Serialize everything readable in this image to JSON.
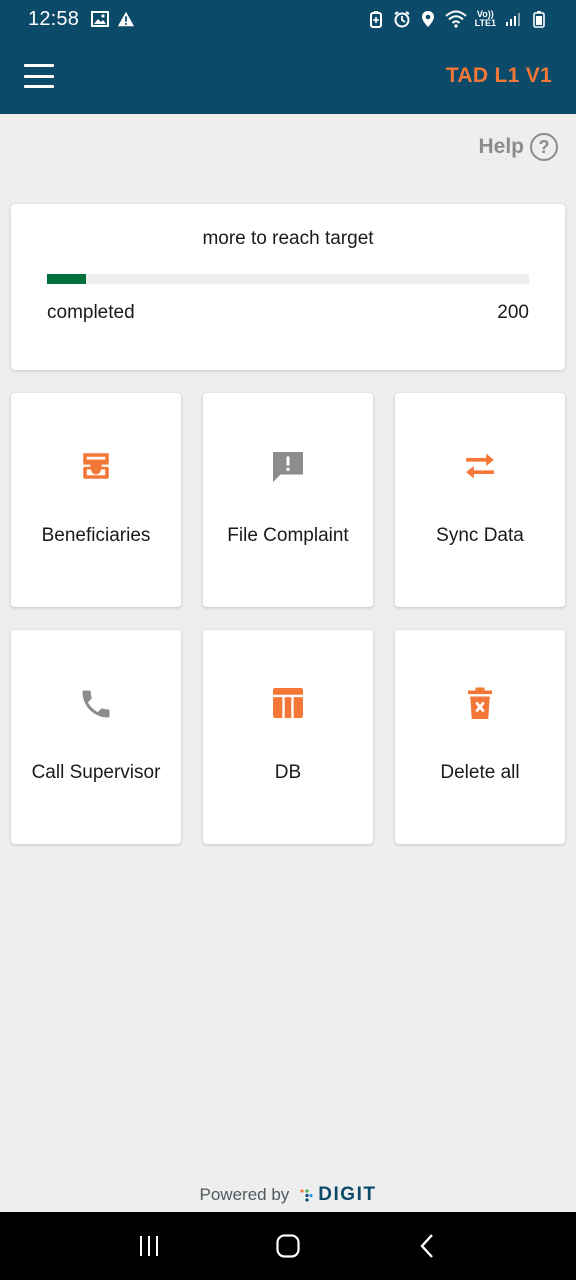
{
  "status_bar": {
    "time": "12:58",
    "network_text_top": "Vo))",
    "network_text_bottom": "LTE1"
  },
  "app_bar": {
    "title": "TAD L1 V1"
  },
  "help": {
    "label": "Help",
    "icon_glyph": "?"
  },
  "target_card": {
    "title": "more to reach target",
    "progress_fraction": 0.08,
    "left_label": "completed",
    "right_label": "200"
  },
  "tiles": [
    {
      "label": "Beneficiaries",
      "icon": "inbox-icon"
    },
    {
      "label": "File Complaint",
      "icon": "feedback-icon"
    },
    {
      "label": "Sync Data",
      "icon": "sync-arrows-icon"
    },
    {
      "label": "Call Supervisor",
      "icon": "phone-icon"
    },
    {
      "label": "DB",
      "icon": "table-icon"
    },
    {
      "label": "Delete all",
      "icon": "delete-icon"
    }
  ],
  "footer": {
    "powered_by": "Powered by",
    "brand": "DIGIT"
  },
  "colors": {
    "header": "#0b4a68",
    "accent": "#f47738",
    "progress": "#00703c",
    "grey_icon": "#8c8c8c"
  }
}
